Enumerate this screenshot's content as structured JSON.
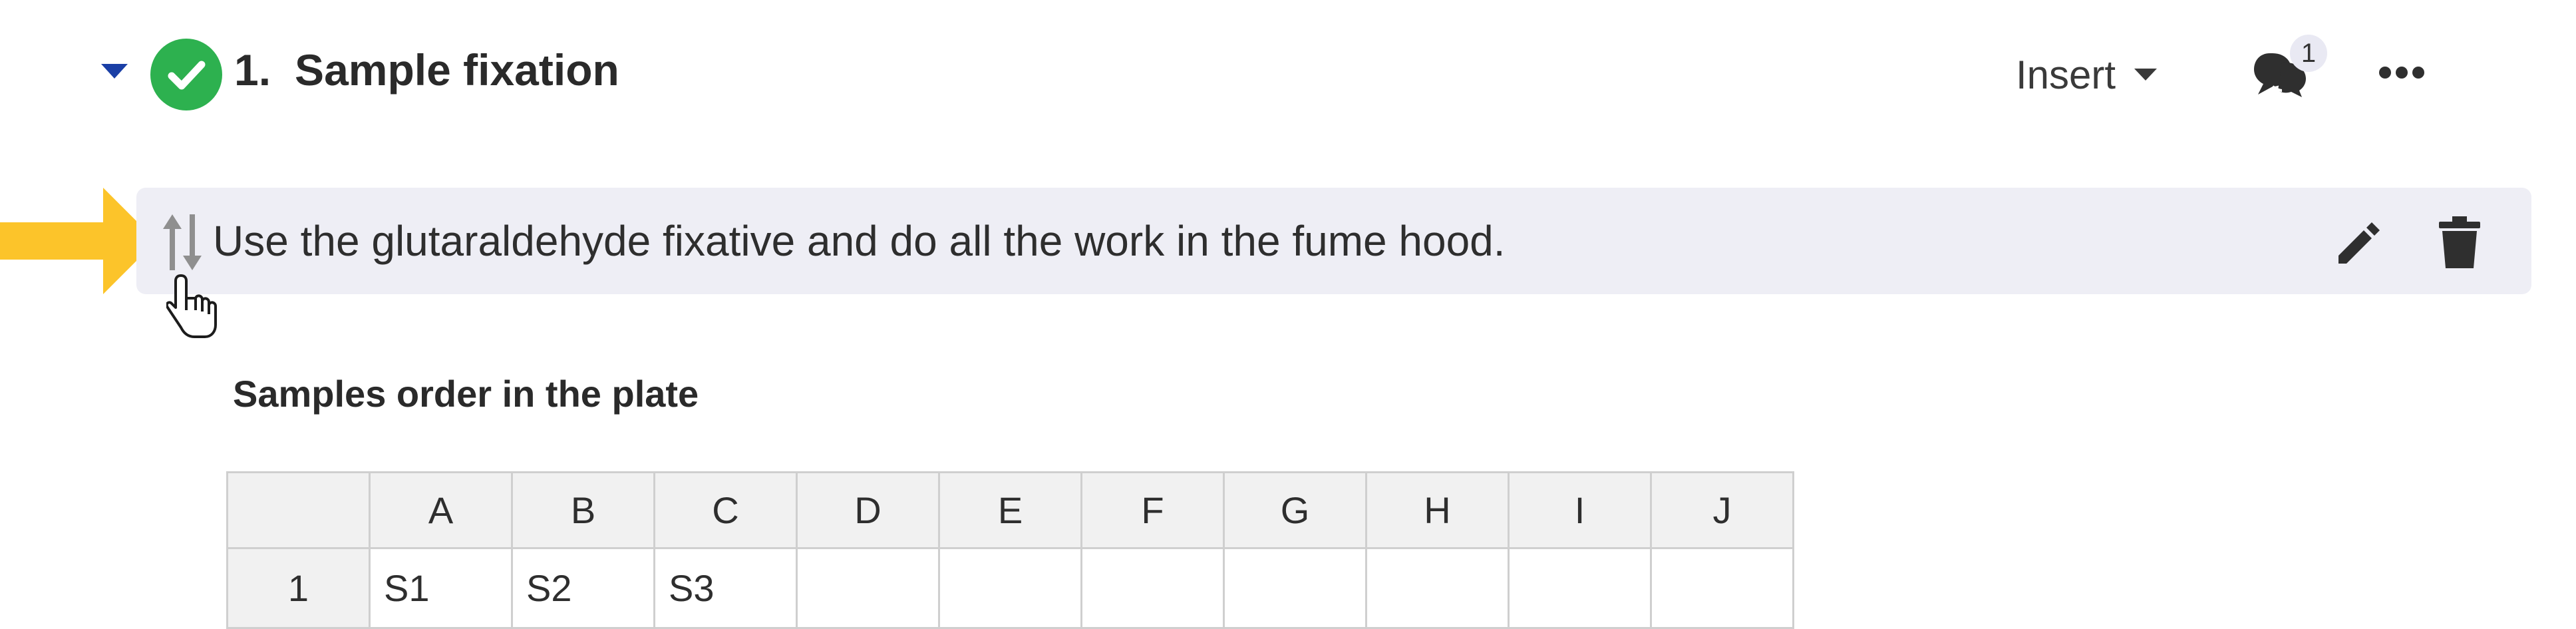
{
  "step": {
    "number": "1.",
    "title": "Sample fixation",
    "insert_label": "Insert",
    "comment_count": "1"
  },
  "instruction": {
    "text": "Use the glutaraldehyde fixative and do all the work in the fume hood."
  },
  "table": {
    "title": "Samples order in the plate",
    "columns": [
      "",
      "A",
      "B",
      "C",
      "D",
      "E",
      "F",
      "G",
      "H",
      "I",
      "J"
    ],
    "rows": [
      {
        "label": "1",
        "cells": [
          "S1",
          "S2",
          "S3",
          "",
          "",
          "",
          "",
          "",
          "",
          ""
        ]
      }
    ]
  },
  "colors": {
    "accent_blue": "#1a3fa6",
    "check_green": "#2db14f",
    "highlight_arrow": "#fcc42a",
    "row_background": "#eeeef5"
  },
  "icons": {
    "expand": "caret-down-icon",
    "status": "check-circle-icon",
    "insert_dropdown": "caret-down-icon",
    "comments": "comments-icon",
    "more": "ellipsis-icon",
    "reorder": "sort-arrows-icon",
    "edit": "pencil-icon",
    "delete": "trash-icon",
    "pointer": "hand-pointer-icon",
    "annotation": "arrow-right-icon"
  }
}
